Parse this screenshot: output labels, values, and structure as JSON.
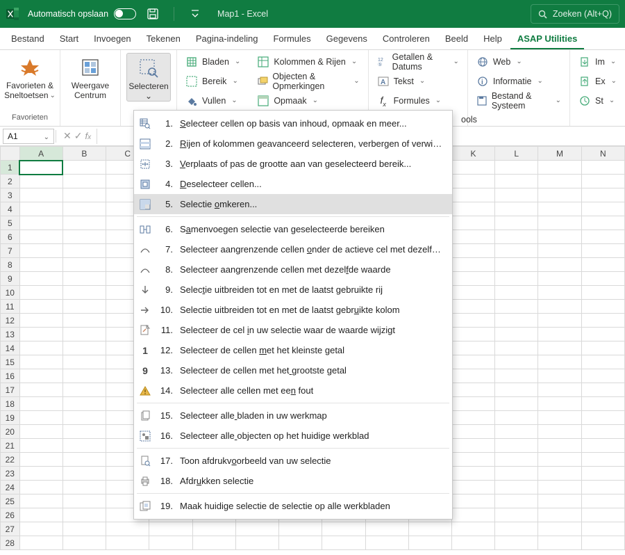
{
  "titlebar": {
    "autosave_label": "Automatisch opslaan",
    "doc_title": "Map1  -  Excel",
    "search_placeholder": "Zoeken (Alt+Q)"
  },
  "tabs": [
    "Bestand",
    "Start",
    "Invoegen",
    "Tekenen",
    "Pagina-indeling",
    "Formules",
    "Gegevens",
    "Controleren",
    "Beeld",
    "Help",
    "ASAP Utilities"
  ],
  "active_tab": 10,
  "ribbon": {
    "group1": {
      "btn1": "Favorieten &\nSneltoetsen",
      "label": "Favorieten"
    },
    "group2": {
      "btn1": "Weergave\nCentrum"
    },
    "group3": {
      "btn1": "Selecteren"
    },
    "col1": [
      "Bladen",
      "Bereik",
      "Vullen"
    ],
    "col2": [
      "Kolommen & Rijen",
      "Objecten & Opmerkingen",
      "Opmaak"
    ],
    "col3": [
      "Getallen & Datums",
      "Tekst",
      "Formules"
    ],
    "col4": [
      "Web",
      "Informatie",
      "Bestand & Systeem"
    ],
    "col5": [
      "Im",
      "Ex",
      "St"
    ]
  },
  "tools_text": "ools",
  "namebox": "A1",
  "columns": [
    "A",
    "B",
    "C",
    "D",
    "E",
    "F",
    "G",
    "H",
    "I",
    "J",
    "K",
    "L",
    "M",
    "N"
  ],
  "rows": 28,
  "selected": {
    "row": 1,
    "col": 0
  },
  "menu": {
    "items": [
      {
        "num": "1.",
        "icon": "grid-search",
        "text": "Selecteer cellen op basis van inhoud, opmaak en meer...",
        "u": 0
      },
      {
        "num": "2.",
        "icon": "grid-rows",
        "text": "Rijen of kolommen geavanceerd selecteren, verbergen of verwijderen...",
        "u": 0
      },
      {
        "num": "3.",
        "icon": "resize",
        "text": "Verplaats of pas de grootte aan van geselecteerd bereik...",
        "u": 0
      },
      {
        "num": "4.",
        "icon": "deselect",
        "text": "Deselecteer cellen...",
        "u": 0
      },
      {
        "num": "5.",
        "icon": "invert",
        "text": "Selectie omkeren...",
        "u": 9,
        "highlight": true
      },
      {
        "sep": true
      },
      {
        "num": "6.",
        "icon": "merge",
        "text": "Samenvoegen selectie van geselecteerde bereiken",
        "u": 1
      },
      {
        "num": "7.",
        "icon": "curve",
        "text": "Selecteer aangrenzende cellen onder de actieve cel met dezelfde waarde",
        "u": 30
      },
      {
        "num": "8.",
        "icon": "curve",
        "text": "Selecteer aangrenzende cellen met dezelfde waarde",
        "u": 39
      },
      {
        "num": "9.",
        "icon": "arrow-down",
        "text": "Selectie uitbreiden tot en met de laatst gebruikte rij",
        "u": 5
      },
      {
        "num": "10.",
        "icon": "arrow-right",
        "text": "Selectie uitbreiden tot en met de laatst gebruikte kolom",
        "u": 45
      },
      {
        "num": "11.",
        "icon": "page-change",
        "text": "Selecteer de cel in uw selectie waar de waarde wijzigt",
        "u": 17
      },
      {
        "num": "12.",
        "icon": "one",
        "text": "Selecteer de cellen met het kleinste getal",
        "u": 20
      },
      {
        "num": "13.",
        "icon": "nine",
        "text": "Selecteer de cellen met het grootste getal",
        "u": 27
      },
      {
        "num": "14.",
        "icon": "warning",
        "text": "Selecteer alle cellen met een fout",
        "u": 28
      },
      {
        "sep": true
      },
      {
        "num": "15.",
        "icon": "sheets",
        "text": "Selecteer alle bladen in uw werkmap",
        "u": 14
      },
      {
        "num": "16.",
        "icon": "objects",
        "text": "Selecteer alle objecten op het huidige werkblad",
        "u": 14
      },
      {
        "sep": true
      },
      {
        "num": "17.",
        "icon": "preview",
        "text": "Toon afdrukvoorbeeld van uw selectie",
        "u": 12
      },
      {
        "num": "18.",
        "icon": "print",
        "text": "Afdrukken selectie",
        "u": 4
      },
      {
        "sep": true
      },
      {
        "num": "19.",
        "icon": "multi",
        "text": "Maak huidige selectie de selectie op alle werkbladen",
        "u": -1
      }
    ]
  }
}
